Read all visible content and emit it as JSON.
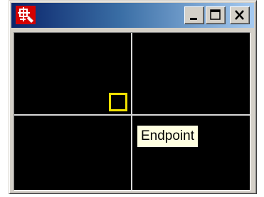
{
  "window": {
    "title_icon": "app-icon",
    "buttons": {
      "minimize": "minimize-icon",
      "maximize": "maximize-icon",
      "close": "close-icon"
    }
  },
  "canvas": {
    "background": "#000000",
    "crosshair_color": "#d8d8d8",
    "snap_marker_color": "#f0e000",
    "tooltip": {
      "text": "Endpoint"
    }
  }
}
